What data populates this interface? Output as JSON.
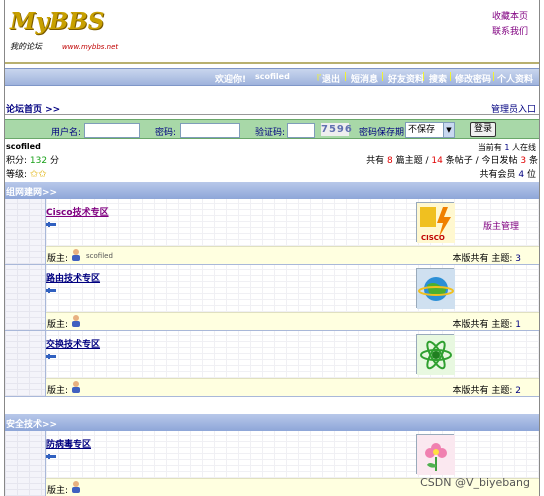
{
  "logo": {
    "title": "MyBBS",
    "subtitle": "我的论坛",
    "url": "www.mybbs.net"
  },
  "top_links": [
    "收藏本页",
    "联系我们"
  ],
  "nav": {
    "welcome": "欢迎你!",
    "username": "scofiled",
    "links": [
      "退出",
      "短消息",
      "好友资料",
      "搜索",
      "修改密码",
      "个人资料"
    ]
  },
  "breadcrumb": "论坛首页 >>",
  "admin_entry": "管理员入口",
  "login": {
    "username_label": "用户名:",
    "password_label": "密码:",
    "captcha_label": "验证码:",
    "captcha_value": "7596",
    "save_label": "密码保存期:",
    "save_value": "不保存",
    "submit_label": "登录"
  },
  "user": {
    "name": "scofiled",
    "points_label": "积分:",
    "points_value": "132",
    "points_unit": "分",
    "level_label": "等级:",
    "online_prefix": "当前有",
    "online_value": "1",
    "online_suffix": "人在线",
    "stats_prefix": "共有",
    "topics_value": "8",
    "topics_label": "篇主题 /",
    "posts_value": "14",
    "posts_label": "条帖子 / 今日发帖",
    "today_value": "3",
    "today_label": "条",
    "members_prefix": "共有会员",
    "members_value": "4",
    "members_suffix": "位"
  },
  "categories": [
    {
      "title": "组网建网>>",
      "forums": [
        {
          "name": "Cisco技术专区",
          "moderator_label": "版主:",
          "moderator_name": "scofiled",
          "count_label": "本版共有 主题:",
          "count_value": "3",
          "manage_label": "版主管理",
          "thumb": "cisco"
        },
        {
          "name": "路由技术专区",
          "moderator_label": "版主:",
          "moderator_name": "",
          "count_label": "本版共有 主题:",
          "count_value": "1",
          "thumb": "globe"
        },
        {
          "name": "交换技术专区",
          "moderator_label": "版主:",
          "moderator_name": "",
          "count_label": "本版共有 主题:",
          "count_value": "2",
          "thumb": "atom"
        }
      ]
    },
    {
      "title": "安全技术>>",
      "forums": [
        {
          "name": "防病毒专区",
          "moderator_label": "版主:",
          "moderator_name": "",
          "thumb": "flower"
        }
      ]
    }
  ],
  "watermark": "CSDN @V_biyebang",
  "colors": {
    "nav_bg": "#9fb3dc",
    "login_bg": "#a8d8a8",
    "footer_bg": "#ffffe0",
    "link": "#000080",
    "visited": "#800080"
  }
}
